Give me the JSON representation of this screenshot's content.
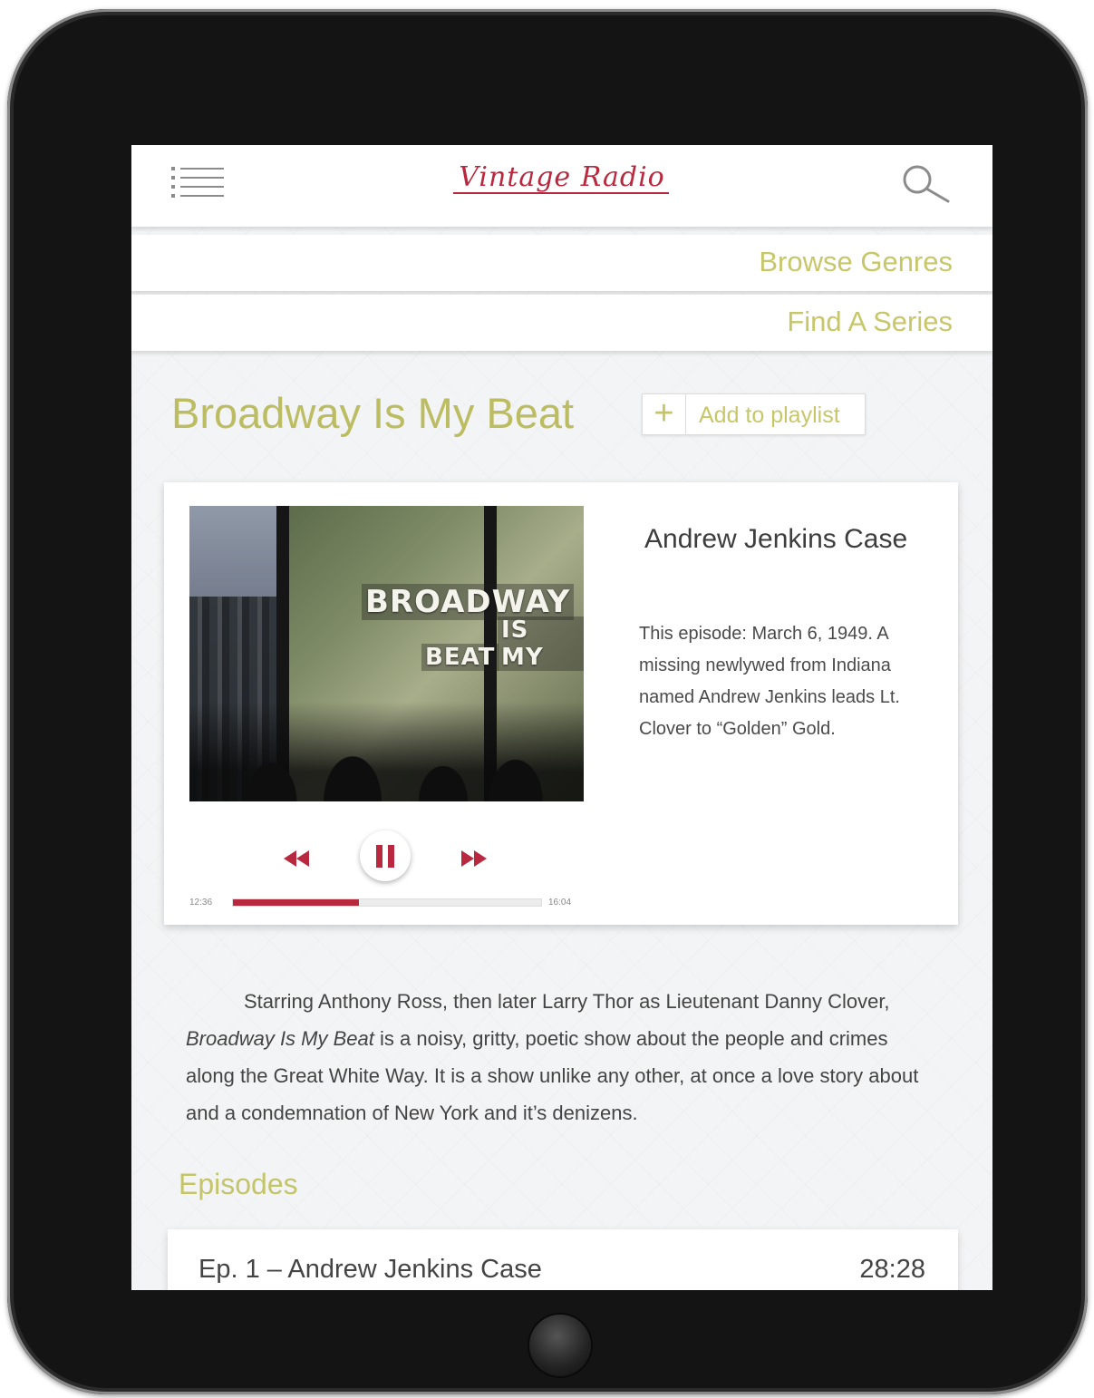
{
  "app": {
    "brand": "Vintage Radio"
  },
  "nav": {
    "browse_genres": "Browse Genres",
    "find_series": "Find A Series"
  },
  "show": {
    "title": "Broadway Is My Beat",
    "add_plus": "+",
    "add_label": "Add to playlist",
    "artwork_text": [
      "BROADWAY",
      "IS MY",
      "BEAT"
    ]
  },
  "player": {
    "episode_name": "Andrew Jenkins Case",
    "description": "This episode:  March 6, 1949. A missing newlywed from Indiana named Andrew Jenkins leads Lt. Clover to “Golden” Gold.",
    "time_elapsed": "12:36",
    "time_total": "16:04",
    "progress_fraction": 0.41,
    "accent_color": "#b8293f",
    "controls": [
      "rewind-icon",
      "pause-icon",
      "fast-forward-icon"
    ]
  },
  "about": {
    "text_before": "Starring Anthony Ross, then later Larry Thor as Lieutenant Danny Clover, ",
    "text_em": "Broadway Is My Beat",
    "text_after": " is a noisy, gritty, poetic show about the people and crimes along the Great White Way. It is a show unlike any other, at once a love story about and a condemnation of New York and it’s denizens."
  },
  "episodes": {
    "heading": "Episodes",
    "items": [
      {
        "title": "Ep. 1 – Andrew Jenkins Case",
        "duration": "28:28"
      }
    ]
  },
  "colors": {
    "accent_red": "#b8293f",
    "olive_text": "#c4c46a"
  }
}
